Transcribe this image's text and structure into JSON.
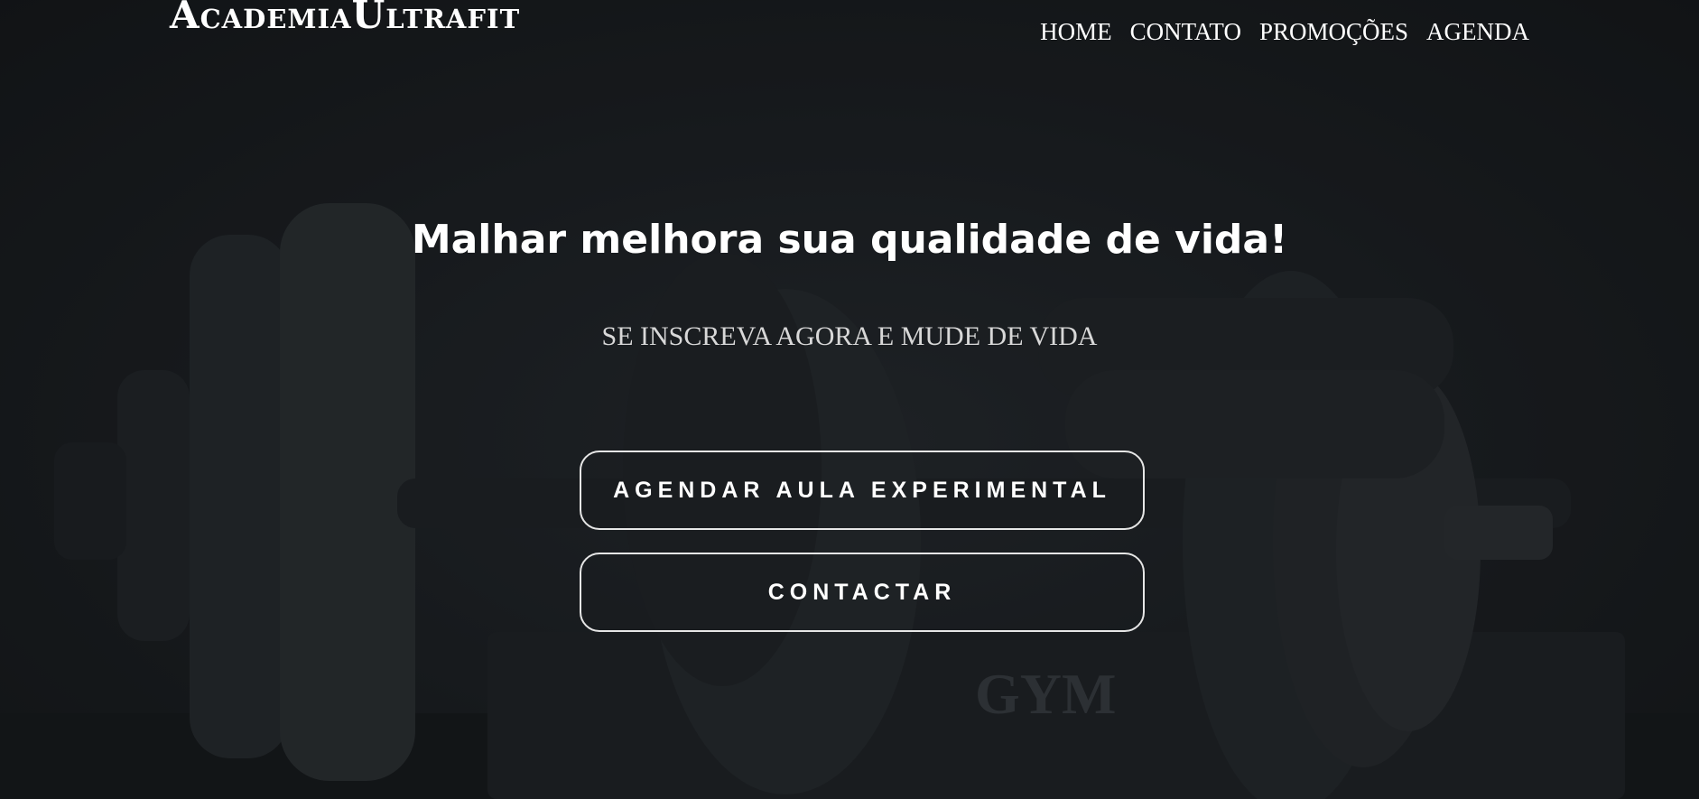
{
  "header": {
    "logo": "AcademiaUltrafit",
    "nav": [
      {
        "label": "HOME"
      },
      {
        "label": "CONTATO"
      },
      {
        "label": "PROMOÇÕES"
      },
      {
        "label": "AGENDA"
      }
    ]
  },
  "hero": {
    "title": "Malhar melhora sua qualidade de vida!",
    "subtitle": "SE INSCREVA AGORA E MUDE DE VIDA",
    "buttons": {
      "trial": "AGENDAR AULA EXPERIMENTAL",
      "contact": "CONTACTAR"
    },
    "background_photo_text": "GYM"
  },
  "colors": {
    "background": "#15181b",
    "text": "#ffffff",
    "button_border": "#e6e6e6"
  }
}
